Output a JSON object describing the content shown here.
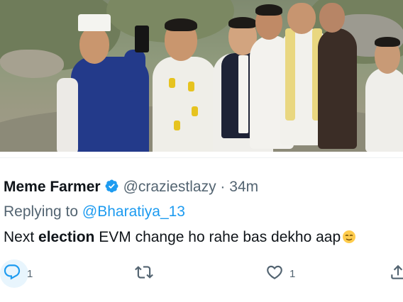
{
  "tweet": {
    "display_name": "Meme Farmer",
    "handle": "@craziestlazy",
    "separator": "·",
    "time": "34m",
    "replying_prefix": "Replying to",
    "replying_to": "@Bharatiya_13",
    "text_before": "Next",
    "text_bold": "election",
    "text_after": "EVM change ho rahe bas dekho aap"
  },
  "actions": {
    "reply_count": "1",
    "retweet_count": "",
    "like_count": "1"
  },
  "icons": {
    "verified": "verified-badge-icon",
    "reply": "reply-icon",
    "retweet": "retweet-icon",
    "like": "heart-icon",
    "share": "share-icon",
    "emoji": "face-emoji-icon"
  },
  "colors": {
    "text": "#0f1419",
    "secondary": "#536471",
    "link": "#1d9bf0",
    "verified": "#1d9bf0"
  }
}
